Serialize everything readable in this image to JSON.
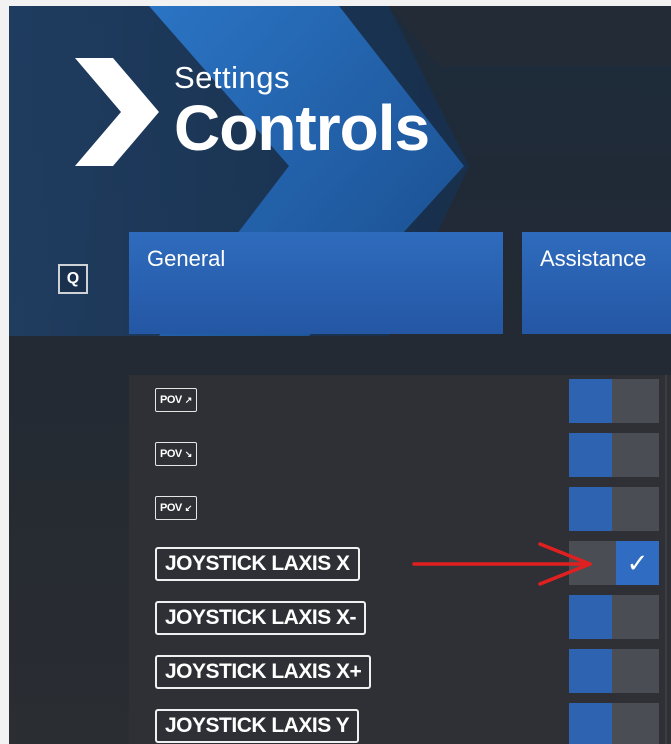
{
  "header": {
    "section": "Settings",
    "title": "Controls"
  },
  "tabs": {
    "shortcut_key": "Q",
    "items": [
      {
        "label": "General"
      },
      {
        "label": "Assistance"
      }
    ]
  },
  "bindings": [
    {
      "label": "POV",
      "arrow": "↗",
      "style": "chip",
      "enabled": false
    },
    {
      "label": "POV",
      "arrow": "↘",
      "style": "chip",
      "enabled": false
    },
    {
      "label": "POV",
      "arrow": "↙",
      "style": "chip",
      "enabled": false
    },
    {
      "label": "JOYSTICK LAXIS X",
      "style": "large",
      "enabled": true
    },
    {
      "label": "JOYSTICK LAXIS X-",
      "style": "large",
      "enabled": false
    },
    {
      "label": "JOYSTICK LAXIS X+",
      "style": "large",
      "enabled": false
    },
    {
      "label": "JOYSTICK LAXIS Y",
      "style": "large",
      "enabled": false
    }
  ],
  "icons": {
    "check": "checkmark-icon",
    "annotation": "red-arrow-annotation"
  },
  "colors": {
    "accent_blue": "#2f6cc2",
    "annotation_red": "#e02020"
  }
}
